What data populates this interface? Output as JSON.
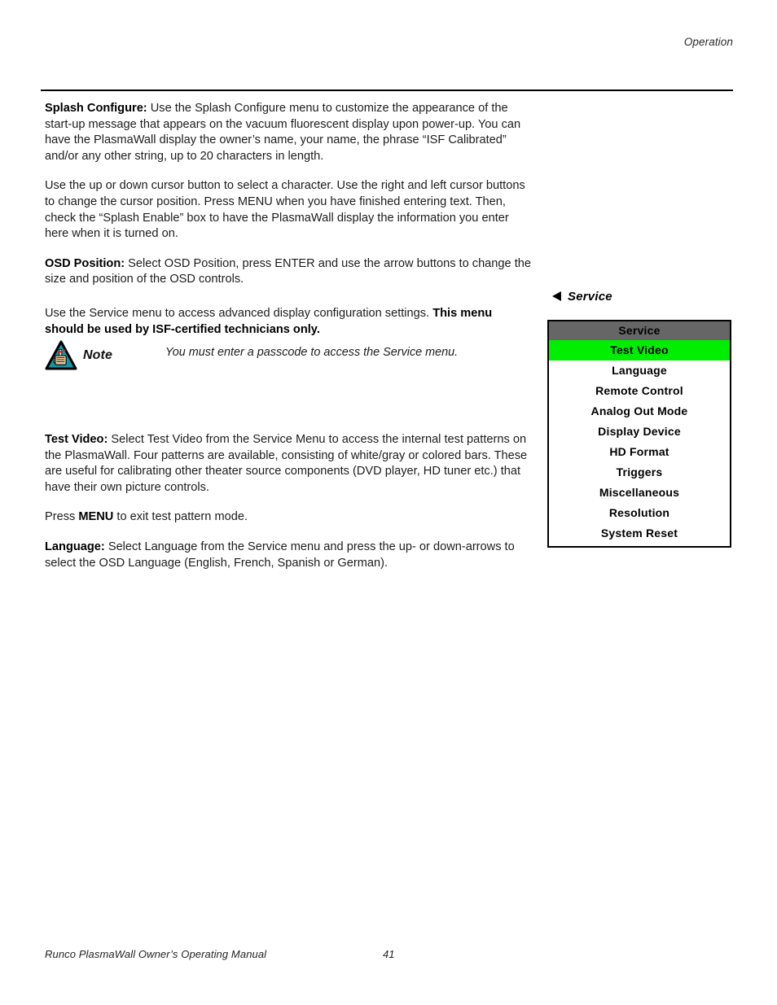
{
  "header": {
    "running_head": "Operation"
  },
  "body": {
    "paragraphs": [
      {
        "lead": "Splash Configure:",
        "text": " Use the Splash Configure menu to customize the appearance of the start-up message that appears on the vacuum fluorescent display upon power-up. You can have the PlasmaWall display the owner’s name, your name, the phrase “ISF Calibrated” and/or any other string, up to 20 characters in length."
      },
      {
        "lead": "",
        "text": "Use the up or down cursor button to select a character. Use the right and left cursor buttons to change the cursor position. Press MENU when you have finished entering text. Then, check the “Splash Enable” box to have the PlasmaWall display the information you enter here when it is turned on."
      },
      {
        "lead": "OSD Position:",
        "text": " Select OSD Position, press ENTER and use the arrow buttons to change the size and position of the OSD controls."
      }
    ],
    "service_intro_plain": "Use the Service menu to access advanced display configuration settings. ",
    "service_intro_bold": "This menu should be used by ISF-certified technicians only."
  },
  "note": {
    "label": "Note",
    "icon": "note-hand-triangle-icon",
    "text": "You must enter a passcode to access the Service menu.",
    "triangle_color": "#1596a8",
    "ribbon_color": "#d9202a",
    "hand_color": "#e8c9a0"
  },
  "body_lower": {
    "test_video_lead": "Test Video:",
    "test_video_text": " Select Test Video from the Service Menu to access the internal test patterns on the PlasmaWall. Four patterns are available, consisting of white/gray or colored bars. These are useful for calibrating other theater source components (DVD player, HD tuner etc.) that have their own picture controls.",
    "press_menu_pre": "Press ",
    "press_menu_key": "MENU",
    "press_menu_post": " to exit test pattern mode.",
    "language_lead": "Language:",
    "language_text": " Select Language from the Service menu and press the up- or down-arrows to select the OSD Language (English, French, Spanish or German)."
  },
  "osd_figure": {
    "caption": "Service",
    "caption_arrow": "left-triangle-icon",
    "menu_title": "Service",
    "title_bg": "#666666",
    "highlight_bg": "#00ee00",
    "items": [
      {
        "label": "Test Video",
        "selected": true
      },
      {
        "label": "Language",
        "selected": false
      },
      {
        "label": "Remote Control",
        "selected": false
      },
      {
        "label": "Analog Out Mode",
        "selected": false
      },
      {
        "label": "Display Device",
        "selected": false
      },
      {
        "label": "HD Format",
        "selected": false
      },
      {
        "label": "Triggers",
        "selected": false
      },
      {
        "label": "Miscellaneous",
        "selected": false
      },
      {
        "label": "Resolution",
        "selected": false
      },
      {
        "label": "System Reset",
        "selected": false
      }
    ]
  },
  "footer": {
    "manual_title": "Runco PlasmaWall Owner’s Operating Manual",
    "page_number": "41"
  }
}
